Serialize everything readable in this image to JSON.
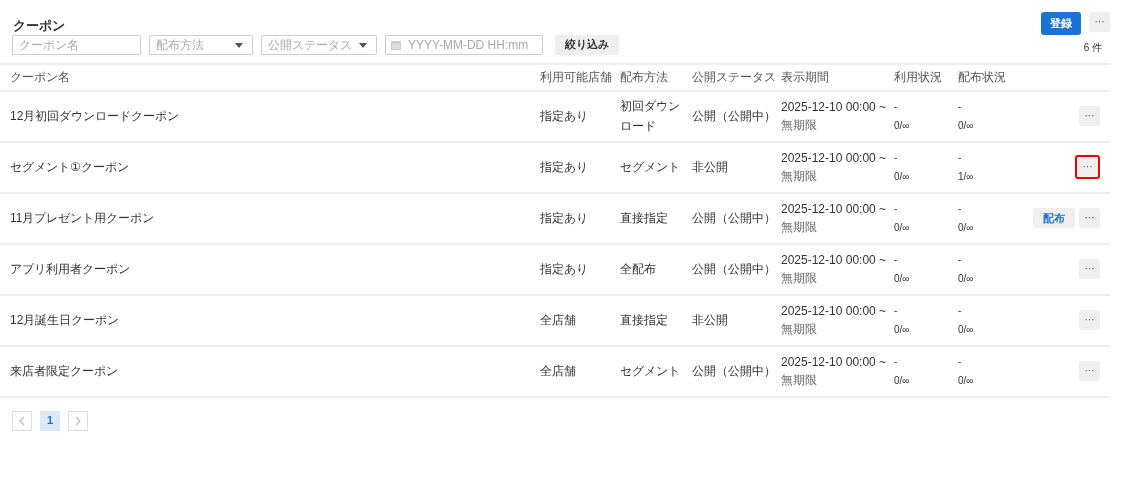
{
  "page_title": "クーポン",
  "header_buttons": {
    "primary": "登録",
    "more": "···"
  },
  "filters": [
    {
      "kind": "text",
      "placeholder": "クーポン名"
    },
    {
      "kind": "select",
      "placeholder": "配布方法"
    },
    {
      "kind": "select",
      "placeholder": "公開ステータス"
    },
    {
      "kind": "date",
      "placeholder": "YYYY-MM-DD HH:mm"
    }
  ],
  "filter_button": "絞り込み",
  "count": "6 件",
  "table": {
    "columns": [
      "クーポン名",
      "利用可能店舗",
      "配布方法",
      "公開ステータス",
      "表示期間",
      "利用状況",
      "配布状況"
    ],
    "rows": [
      {
        "name": "12月初回ダウンロードクーポン",
        "stores": "指定あり",
        "method": "初回ダウンロード",
        "status": "公開（公開中）",
        "period": [
          "2025-12-10 00:00 ~",
          "無期限"
        ],
        "usage": [
          "-",
          "0/∞"
        ],
        "distribution": [
          "-",
          "0/∞"
        ],
        "actions": [
          "···"
        ],
        "highlighted": false
      },
      {
        "name": "セグメント①クーポン",
        "stores": "指定あり",
        "method": "セグメント",
        "status": "非公開",
        "period": [
          "2025-12-10 00:00 ~",
          "無期限"
        ],
        "usage": [
          "-",
          "0/∞"
        ],
        "distribution": [
          "-",
          "1/∞"
        ],
        "actions": [
          "···"
        ],
        "highlighted": true
      },
      {
        "name": "11月プレゼント用クーポン",
        "stores": "指定あり",
        "method": "直接指定",
        "status": "公開（公開中）",
        "period": [
          "2025-12-10 00:00 ~",
          "無期限"
        ],
        "usage": [
          "-",
          "0/∞"
        ],
        "distribution": [
          "-",
          "0/∞"
        ],
        "actions": [
          "配布",
          "···"
        ],
        "highlighted": false
      },
      {
        "name": "アプリ利用者クーポン",
        "stores": "指定あり",
        "method": "全配布",
        "status": "公開（公開中）",
        "period": [
          "2025-12-10 00:00 ~",
          "無期限"
        ],
        "usage": [
          "-",
          "0/∞"
        ],
        "distribution": [
          "-",
          "0/∞"
        ],
        "actions": [
          "···"
        ],
        "highlighted": false
      },
      {
        "name": "12月誕生日クーポン",
        "stores": "全店舗",
        "method": "直接指定",
        "status": "非公開",
        "period": [
          "2025-12-10 00:00 ~",
          "無期限"
        ],
        "usage": [
          "-",
          "0/∞"
        ],
        "distribution": [
          "-",
          "0/∞"
        ],
        "actions": [
          "···"
        ],
        "highlighted": false
      },
      {
        "name": "来店者限定クーポン",
        "stores": "全店舗",
        "method": "セグメント",
        "status": "公開（公開中）",
        "period": [
          "2025-12-10 00:00 ~",
          "無期限"
        ],
        "usage": [
          "-",
          "0/∞"
        ],
        "distribution": [
          "-",
          "0/∞"
        ],
        "actions": [
          "···"
        ],
        "highlighted": false
      }
    ]
  },
  "pagination": {
    "pages": [
      {
        "label": "1",
        "selected": true
      }
    ]
  }
}
